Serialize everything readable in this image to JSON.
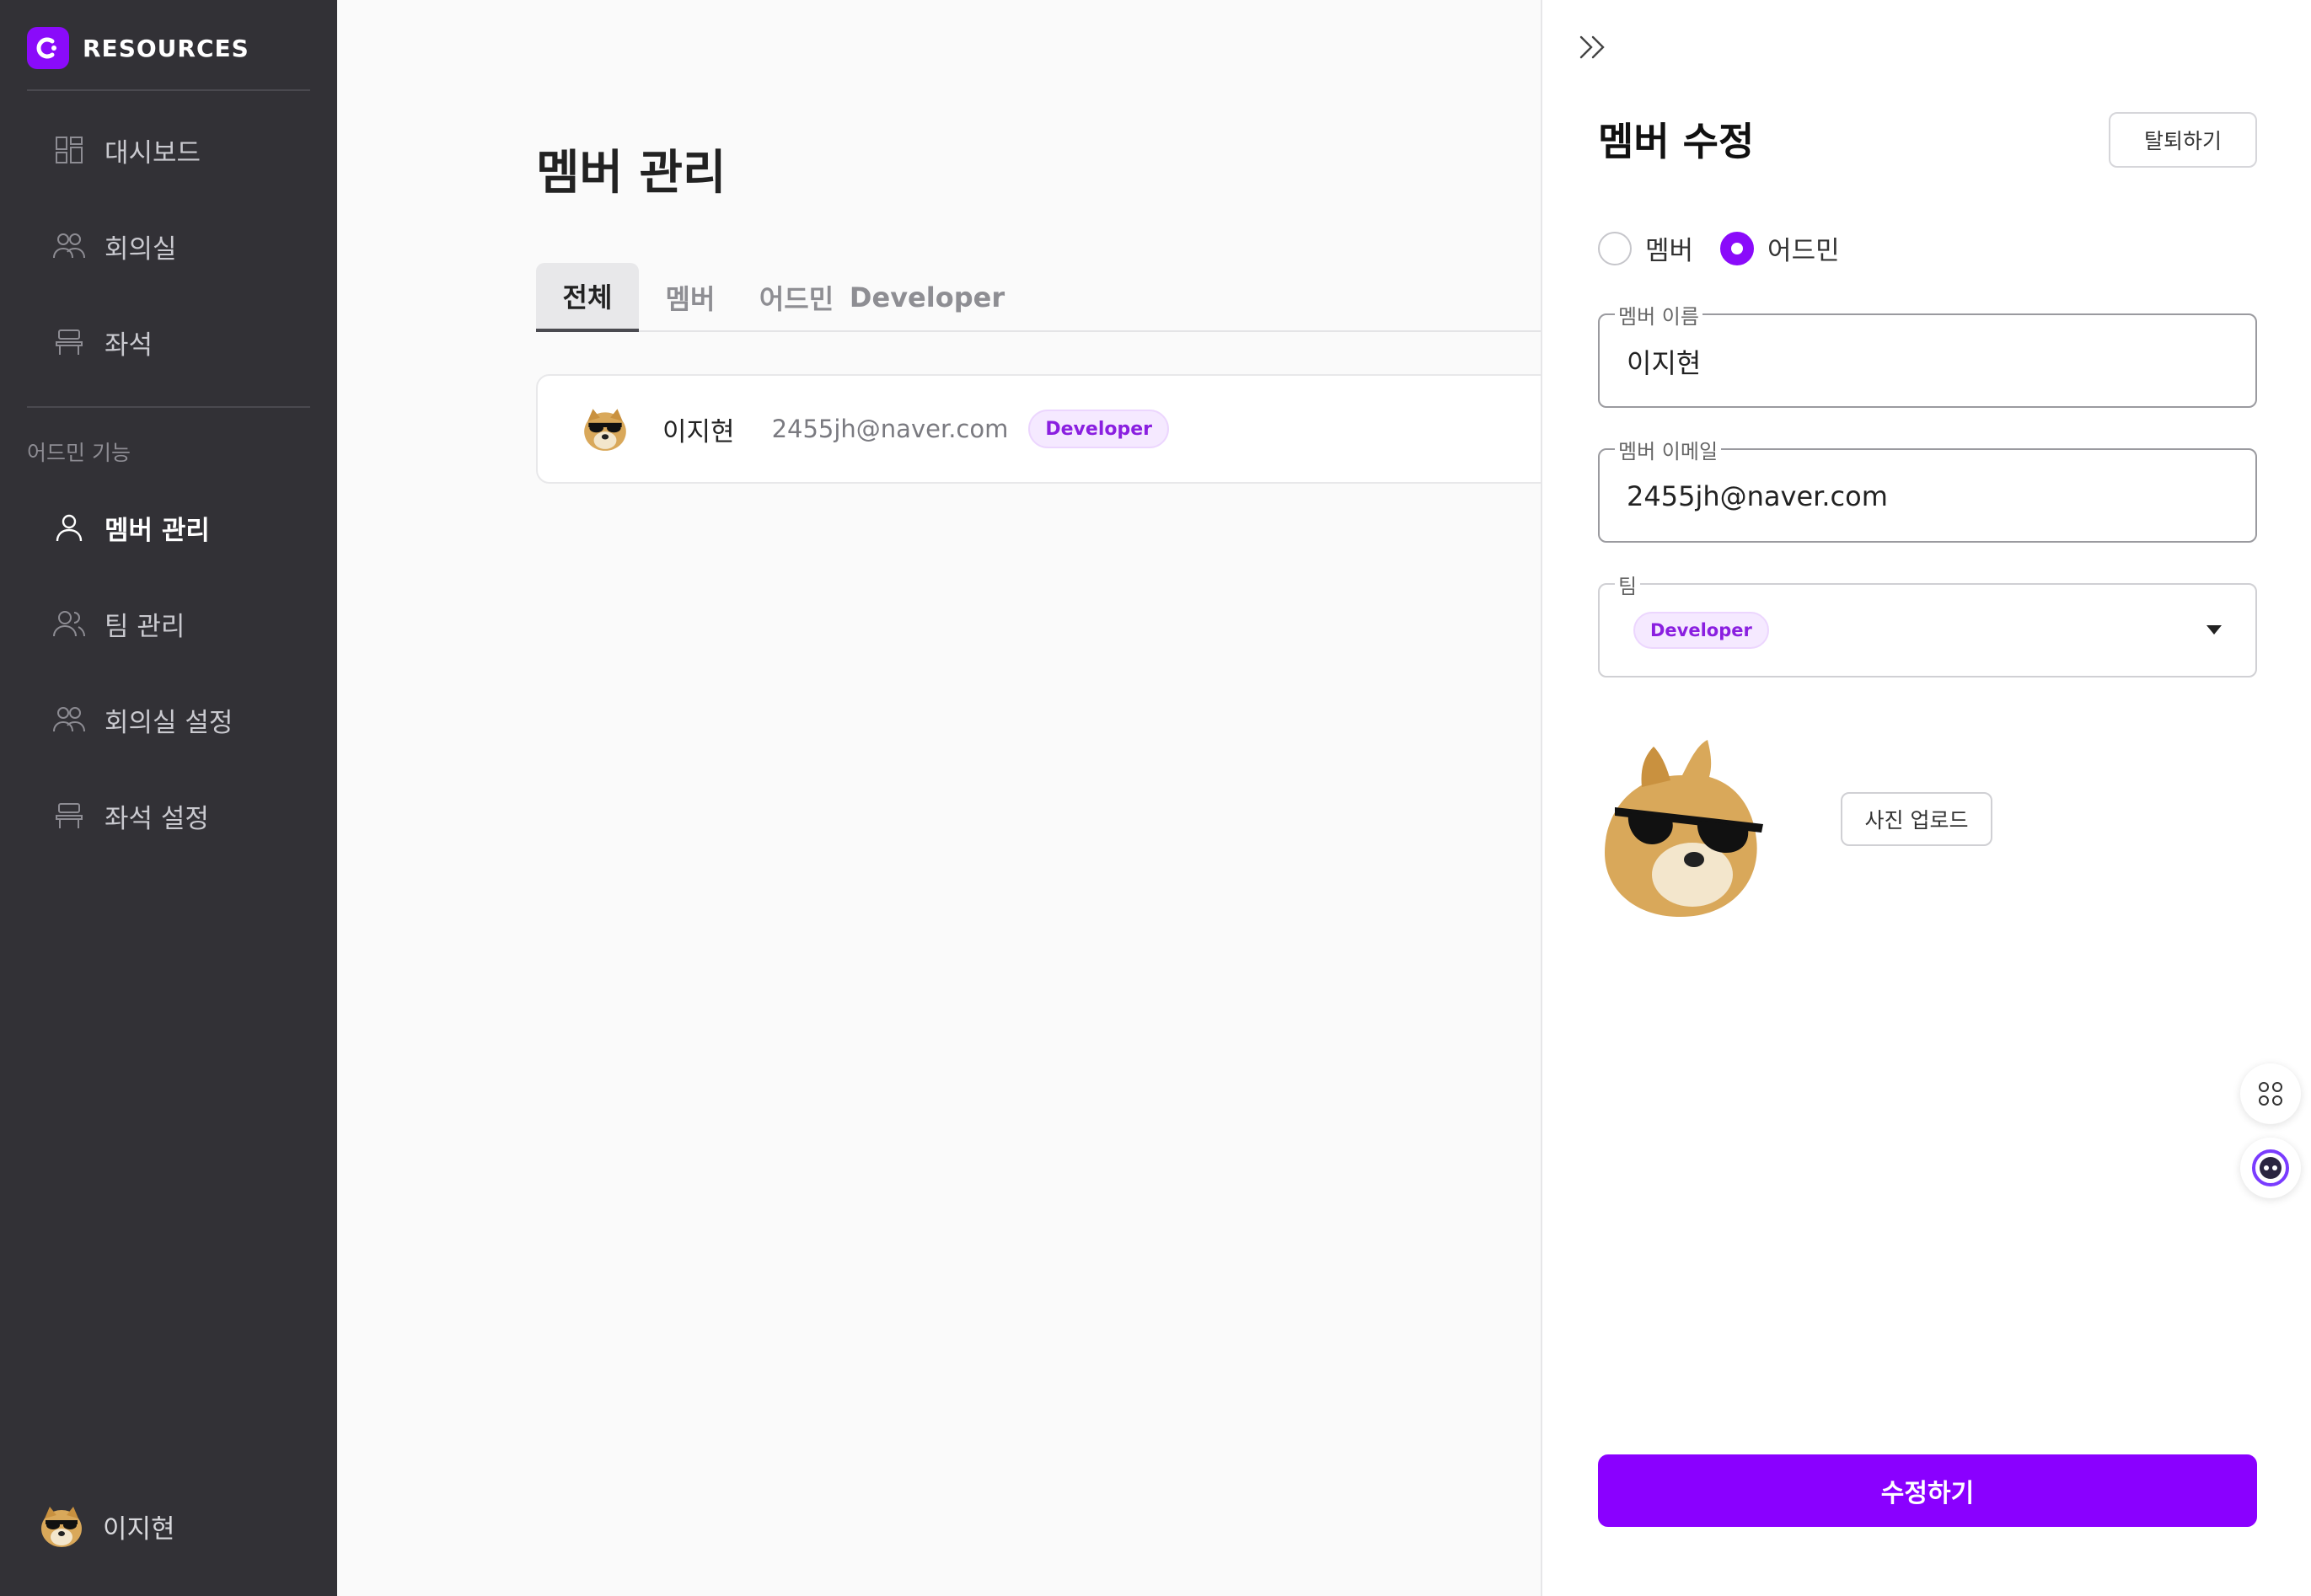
{
  "brand": {
    "name": "RESOURCES",
    "color": "#8a0bfa"
  },
  "sidebar": {
    "items": [
      {
        "label": "대시보드",
        "icon": "dashboard-icon"
      },
      {
        "label": "회의실",
        "icon": "people-icon"
      },
      {
        "label": "좌석",
        "icon": "seat-icon"
      }
    ],
    "admin_section_label": "어드민 기능",
    "admin_items": [
      {
        "label": "멤버 관리",
        "icon": "user-icon",
        "active": true
      },
      {
        "label": "팀 관리",
        "icon": "team-icon"
      },
      {
        "label": "회의실 설정",
        "icon": "people-icon"
      },
      {
        "label": "좌석 설정",
        "icon": "seat-icon"
      }
    ],
    "user_name": "이지현"
  },
  "main": {
    "title": "멤버 관리",
    "tabs": [
      {
        "label": "전체",
        "active": true
      },
      {
        "label": "멤버"
      },
      {
        "label": "어드민"
      },
      {
        "label": "Developer"
      }
    ],
    "members": [
      {
        "name": "이지현",
        "email": "2455jh@naver.com",
        "team": "Developer"
      }
    ]
  },
  "panel": {
    "title": "멤버 수정",
    "withdraw_label": "탈퇴하기",
    "role_options": [
      {
        "label": "멤버",
        "selected": false
      },
      {
        "label": "어드민",
        "selected": true
      }
    ],
    "name_field": {
      "legend": "멤버 이름",
      "value": "이지현"
    },
    "email_field": {
      "legend": "멤버 이메일",
      "value": "2455jh@naver.com"
    },
    "team_field": {
      "legend": "팀",
      "selected": "Developer"
    },
    "upload_label": "사진 업로드",
    "submit_label": "수정하기"
  },
  "colors": {
    "accent": "#8a00ff",
    "sidebar_bg": "#323136",
    "badge_bg": "#f5e9ff",
    "badge_text": "#8a1fe0"
  }
}
